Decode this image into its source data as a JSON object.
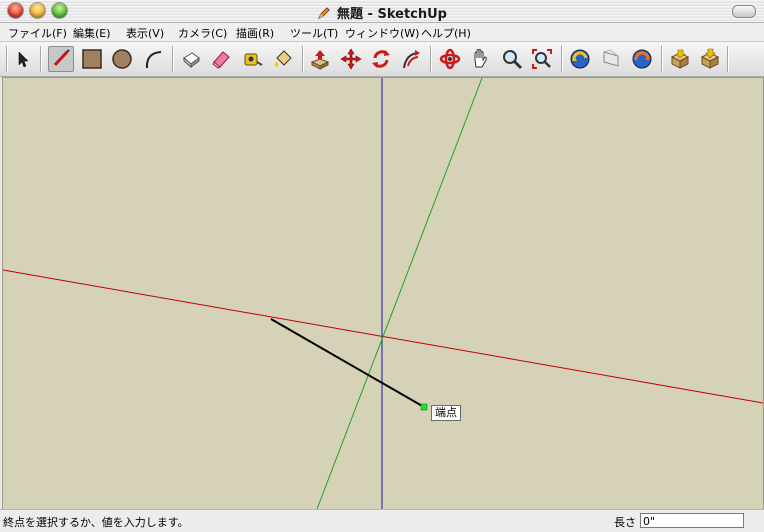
{
  "window": {
    "title": "無題 - SketchUp"
  },
  "menu": {
    "items": [
      {
        "label": "ファイル(F)"
      },
      {
        "label": "編集(E)"
      },
      {
        "label": "表示(V)"
      },
      {
        "label": "カメラ(C)"
      },
      {
        "label": "描画(R)"
      },
      {
        "label": "ツール(T)"
      },
      {
        "label": "ウィンドウ(W)"
      },
      {
        "label": "ヘルプ(H)"
      }
    ]
  },
  "toolbar": {
    "tools": [
      {
        "name": "select-tool-icon"
      },
      {
        "name": "line-tool-icon",
        "active": true
      },
      {
        "name": "rectangle-tool-icon"
      },
      {
        "name": "circle-tool-icon"
      },
      {
        "name": "arc-tool-icon"
      },
      {
        "name": "make-component-icon"
      },
      {
        "name": "eraser-icon"
      },
      {
        "name": "tape-measure-icon"
      },
      {
        "name": "paint-bucket-icon"
      },
      {
        "name": "push-pull-icon"
      },
      {
        "name": "move-icon"
      },
      {
        "name": "rotate-icon"
      },
      {
        "name": "follow-me-icon"
      },
      {
        "name": "orbit-icon"
      },
      {
        "name": "pan-icon"
      },
      {
        "name": "zoom-icon"
      },
      {
        "name": "zoom-extents-icon"
      },
      {
        "name": "previous-view-icon"
      },
      {
        "name": "next-view-icon"
      },
      {
        "name": "section-plane-icon"
      },
      {
        "name": "get-models-icon"
      },
      {
        "name": "share-model-icon"
      }
    ]
  },
  "viewport": {
    "background": "#d5d2b8",
    "axis_colors": {
      "red": "#c00000",
      "green": "#22a022",
      "blue": "#1a1aa0"
    },
    "inference_tooltip": "端点"
  },
  "status": {
    "message": "終点を選択するか、値を入力します。",
    "vcb_label": "長さ",
    "vcb_value": "0\""
  }
}
